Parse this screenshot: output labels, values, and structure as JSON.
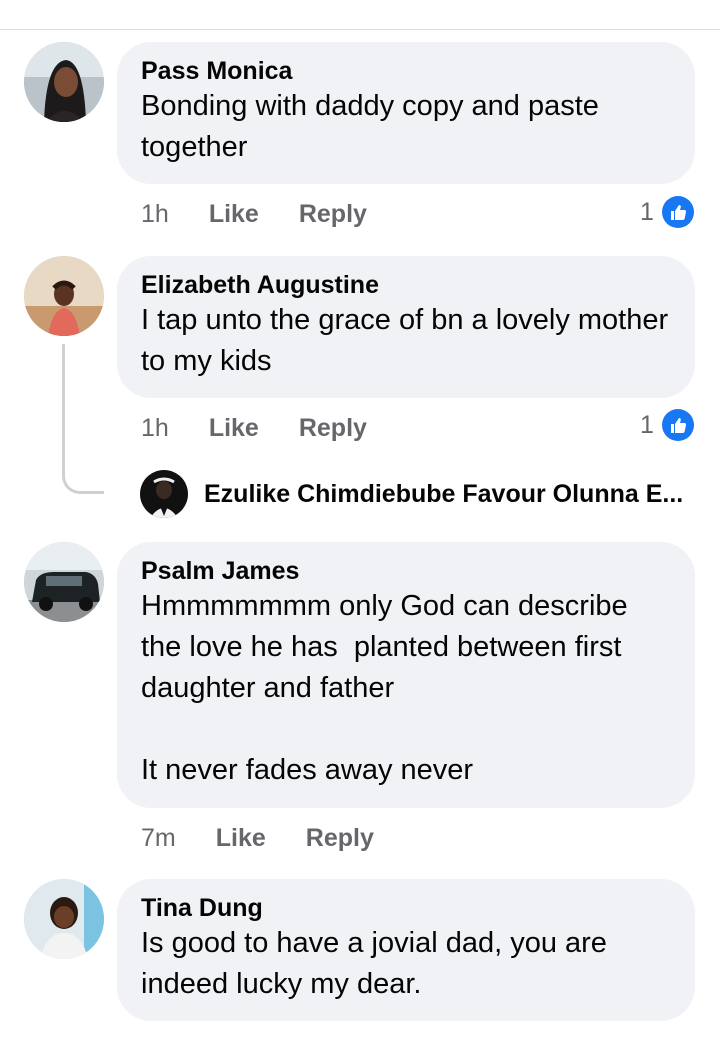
{
  "comments": [
    {
      "author": "Pass Monica",
      "text": "Bonding with daddy copy and paste together",
      "time": "1h",
      "like_label": "Like",
      "reply_label": "Reply",
      "reaction_count": "1",
      "reaction_icon": "thumbs-up-icon"
    },
    {
      "author": "Elizabeth Augustine",
      "text": "I tap unto the grace of bn a lovely mother to my kids",
      "time": "1h",
      "like_label": "Like",
      "reply_label": "Reply",
      "reaction_count": "1",
      "reaction_icon": "thumbs-up-icon",
      "reply_preview": "Ezulike Chimdiebube Favour Olunna E..."
    },
    {
      "author": "Psalm James",
      "text": "Hmmmmmmm only God can describe the love he has  planted between first daughter and father\n\nIt never fades away never",
      "time": "7m",
      "like_label": "Like",
      "reply_label": "Reply"
    },
    {
      "author": "Tina Dung",
      "text": "Is good to have a jovial dad, you are indeed lucky my dear."
    }
  ],
  "colors": {
    "bubble_bg": "#f0f2f5",
    "secondary_text": "#65676b",
    "like_blue": "#1877f2"
  }
}
